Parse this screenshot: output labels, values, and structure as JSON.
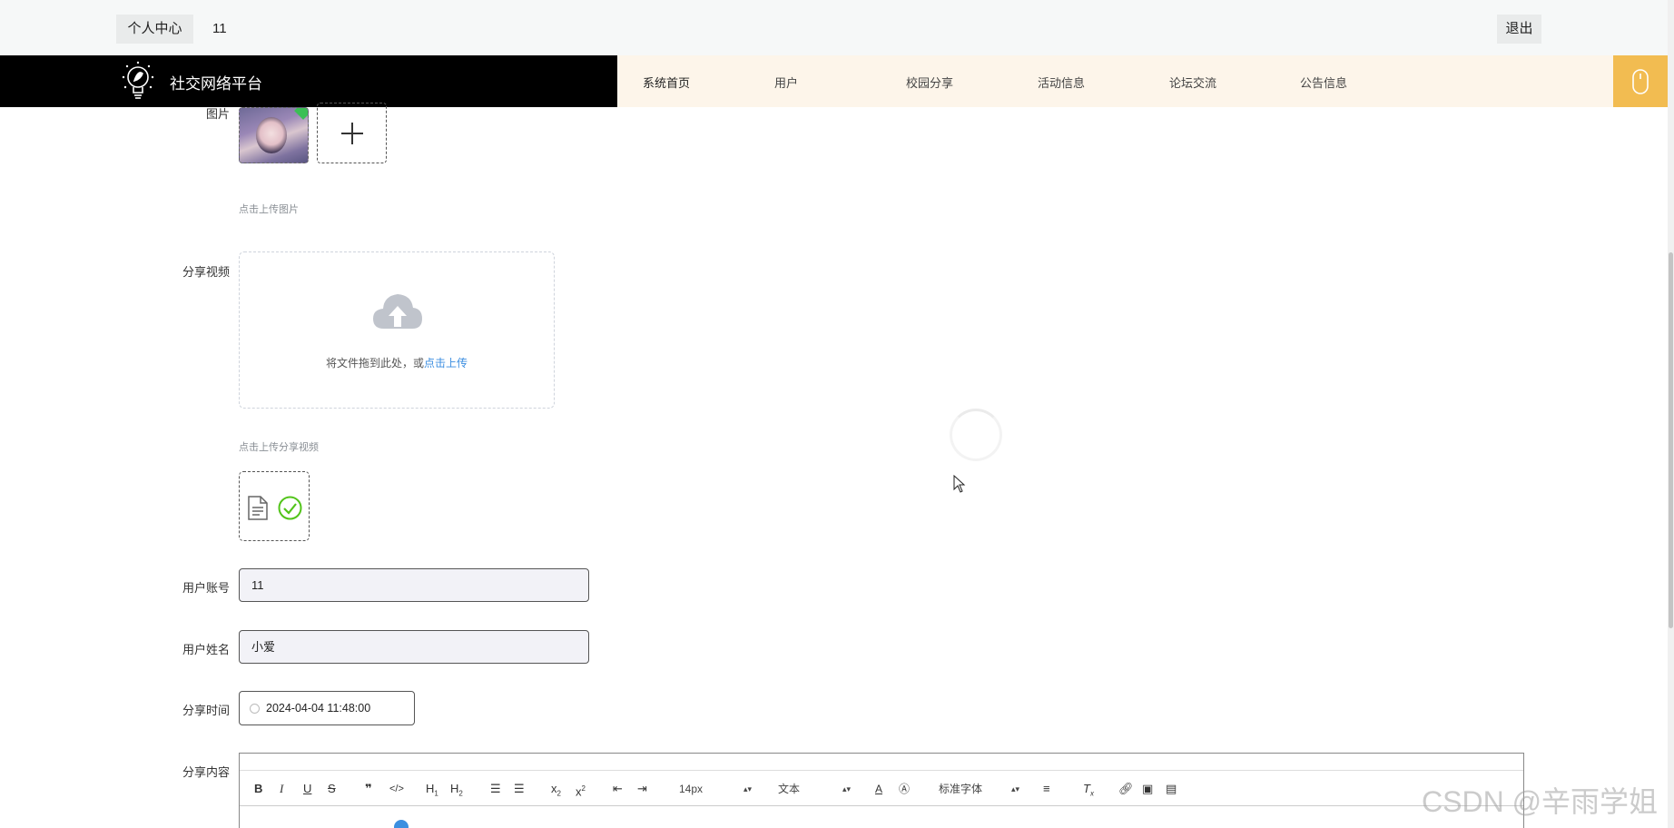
{
  "topbar": {
    "personal_center": "个人中心",
    "username": "11",
    "logout": "退出"
  },
  "nav": {
    "brand_title": "社交网络平台",
    "items": [
      {
        "label": "系统首页"
      },
      {
        "label": "用户"
      },
      {
        "label": "校园分享"
      },
      {
        "label": "活动信息"
      },
      {
        "label": "论坛交流"
      },
      {
        "label": "公告信息"
      }
    ]
  },
  "form": {
    "image_label": "图片",
    "image_hint": "点击上传图片",
    "video_label": "分享视频",
    "dropzone_text": "将文件拖到此处，或",
    "dropzone_link": "点击上传",
    "video_hint": "点击上传分享视频",
    "account_label": "用户账号",
    "account_value": "11",
    "name_label": "用户姓名",
    "name_value": "小爱",
    "time_label": "分享时间",
    "time_value": "2024-04-04 11:48:00",
    "content_label": "分享内容"
  },
  "editor": {
    "font_size": "14px",
    "block_type": "文本",
    "font_family": "标准字体"
  },
  "watermark": "CSDN @辛雨学姐",
  "colors": {
    "nav_brand_bg": "#000000",
    "nav_menu_bg": "#fdf5ea",
    "nav_accent": "#f2bc51",
    "link": "#3b8ee0",
    "success": "#52c41a"
  }
}
